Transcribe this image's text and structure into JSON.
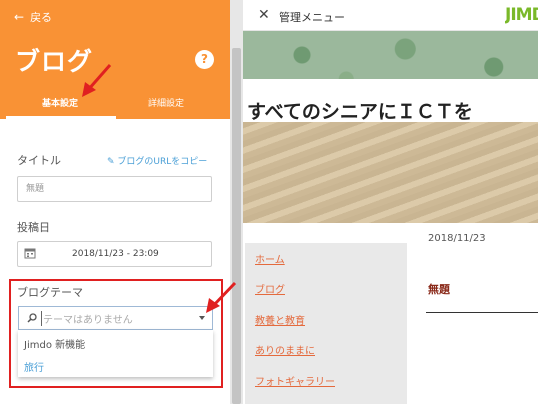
{
  "panel": {
    "back_label": "戻る",
    "title": "ブログ",
    "help_label": "?",
    "tabs": [
      "基本設定",
      "詳細設定"
    ],
    "title_field": {
      "label": "タイトル",
      "value": "無題"
    },
    "copy_url_label": "✎ ブログのURLをコピー",
    "date_field": {
      "label": "投稿日",
      "value": "2018/11/23 - 23:09"
    },
    "theme": {
      "label": "ブログテーマ",
      "placeholder": "テーマはありません",
      "options": [
        "Jimdo 新機能",
        "旅行"
      ]
    }
  },
  "topbar": {
    "menu_label": "管理メニュー",
    "logo_text": "JIMDO"
  },
  "site": {
    "title": "すべてのシニアにＩＣＴを",
    "nav": [
      "ホーム",
      "ブログ",
      "教養と教育",
      "ありのままに",
      "フォトギャラリー"
    ],
    "post_date": "2018/11/23",
    "post_title": "無題"
  },
  "colors": {
    "accent": "#f99235",
    "link": "#4a9fd6",
    "highlight": "#e02020",
    "nav_link": "#e46a3d"
  },
  "icons": [
    "back-arrow-icon",
    "help-icon",
    "calendar-icon",
    "search-icon",
    "chevron-down-icon",
    "close-icon"
  ]
}
